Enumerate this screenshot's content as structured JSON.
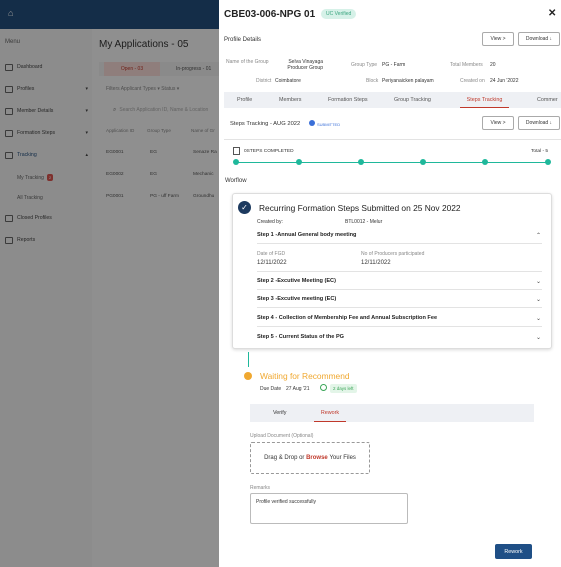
{
  "bg": {
    "title": "My Applications - 05",
    "menu_label": "Menu",
    "sidebar": [
      {
        "label": "Dashboard"
      },
      {
        "label": "Profiles",
        "chev": "▾"
      },
      {
        "label": "Member Details",
        "chev": "▾"
      },
      {
        "label": "Formation Steps",
        "chev": "▾"
      },
      {
        "label": "Tracking",
        "chev": "▴"
      },
      {
        "label": "Closed Profiles"
      },
      {
        "label": "Reports"
      }
    ],
    "sub_items": [
      "My Tracking",
      "All Tracking"
    ],
    "my_tracking_badge": "2",
    "tabs": [
      "Open - 03",
      "In-progress - 01"
    ],
    "filters": "Filters  Applicant Types ▾   Status ▾",
    "search_placeholder": "Search Application ID, Name & Location",
    "table_headers": [
      "Application ID",
      "Group Type",
      "Name of Gr"
    ],
    "rows": [
      [
        "EG0001",
        "EG",
        "Senaze Ra"
      ],
      [
        "EG0002",
        "EG",
        "Mechanic"
      ],
      [
        "PG0001",
        "PG - uff Farm",
        "Groundhu"
      ]
    ]
  },
  "panel": {
    "title": "CBE03-006-NPG 01",
    "status_badge": "UC Verified",
    "close": "✕",
    "profile_details": "Profile Details",
    "view_btn": "View  >",
    "download_btn": "Download  ↓",
    "fields": {
      "name_label": "Name of the Group",
      "name_value": "Selva Vinayaga Producer Group",
      "group_type_label": "Group Type",
      "group_type_value": "PG - Farm",
      "total_members_label": "Total Members",
      "total_members_value": "20",
      "district_label": "District",
      "district_value": "Coimbatore",
      "block_label": "Block",
      "block_value": "Periyanaicken palayam",
      "created_label": "Created on",
      "created_value": "24 Jun '2022"
    },
    "tabs": [
      "Profile",
      "Members",
      "Formation Steps",
      "Group Tracking",
      "Steps Tracking",
      "Commer"
    ],
    "steps_tracking_title": "Steps Tracking - AUG 2022",
    "submitted_badge": "SUBMITTED",
    "steps_completed": "0STEPS COMPLETED",
    "total": "Total - 5",
    "workflow": "Worflow",
    "card": {
      "title": "Recurring Formation Steps Submitted on 25 Nov 2022",
      "created_by_label": "Created  by:",
      "created_by_value": "BTL0012 - Melur",
      "step1": "Step 1 -Annual General body meeting",
      "date_label": "Date of FGD",
      "date_value": "12/11/2022",
      "producers_label": "No of Producers participated",
      "producers_value": "12/11/2022",
      "step2": "Step 2 -Excutive Meeting (EC)",
      "step3": "Step 3 -Excutive meeting (EC)",
      "step4": "Step 4 - Collection of Membership Fee and Annual Subscription Fee",
      "step5": "Step 5 - Current Status of the PG"
    },
    "waiting": {
      "title": "Waiting for Recommend",
      "due_label": "Due Date",
      "due_value": "27 Aug '21",
      "left_badge": "2 days left",
      "verify_tab": "Verify",
      "rework_tab": "Rework",
      "upload_label": "Upload Document (Optional)",
      "drop_text": "Drag & Drop or",
      "browse": "Browse",
      "your_files": "Your Files",
      "remarks_label": "Remarks",
      "remarks_value": "Profile verified successfully",
      "rework_btn": "Rework"
    }
  },
  "colors": {
    "brand": "#234e7d",
    "accent_red": "#c0392b",
    "teal": "#1fb89b",
    "orange": "#f0a830",
    "primary_btn": "#1f4f86"
  }
}
